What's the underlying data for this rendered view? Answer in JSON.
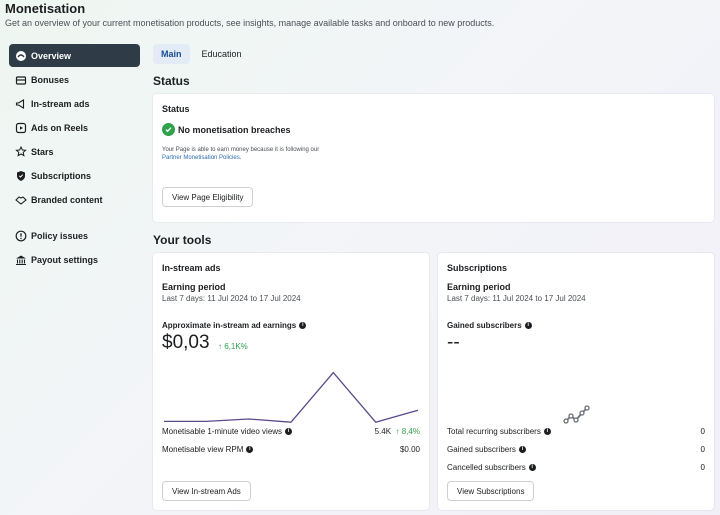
{
  "header": {
    "title": "Monetisation",
    "subtitle": "Get an overview of your current monetisation products, see insights, manage available tasks and onboard to new products."
  },
  "sidebar": {
    "items": [
      {
        "label": "Overview",
        "icon": "overview-icon"
      },
      {
        "label": "Bonuses",
        "icon": "bonus-icon"
      },
      {
        "label": "In-stream ads",
        "icon": "megaphone-icon"
      },
      {
        "label": "Ads on Reels",
        "icon": "reels-icon"
      },
      {
        "label": "Stars",
        "icon": "stars-icon"
      },
      {
        "label": "Subscriptions",
        "icon": "shield-icon"
      },
      {
        "label": "Branded content",
        "icon": "handshake-icon"
      },
      {
        "label": "Policy issues",
        "icon": "alert-icon"
      },
      {
        "label": "Payout settings",
        "icon": "bank-icon"
      }
    ]
  },
  "tabs": [
    {
      "label": "Main"
    },
    {
      "label": "Education"
    }
  ],
  "status": {
    "section_title": "Status",
    "card_title": "Status",
    "headline": "No monetisation breaches",
    "desc_line1": "Your Page is able to earn money because it is following our",
    "desc_link": "Partner Monetisation Policies",
    "desc_end": ".",
    "button": "View Page Eligibility"
  },
  "tools": {
    "section_title": "Your tools",
    "instream": {
      "title": "In-stream ads",
      "period_label": "Earning period",
      "period_value": "Last 7 days: 11 Jul 2024 to 17 Jul 2024",
      "metric_label": "Approximate in-stream ad earnings",
      "metric_value": "$0,03",
      "metric_delta": "↑ 6,1K%",
      "row1_label": "Monetisable 1-minute video views",
      "row1_value": "5.4K",
      "row1_delta": "↑ 8,4%",
      "row2_label": "Monetisable view RPM",
      "row2_value": "$0.00",
      "button": "View In-stream Ads",
      "line_color": "#5b4a8b"
    },
    "subscriptions": {
      "title": "Subscriptions",
      "period_label": "Earning period",
      "period_value": "Last 7 days: 11 Jul 2024 to 17 Jul 2024",
      "metric_label": "Gained subscribers",
      "metric_value": "--",
      "row1_label": "Total recurring subscribers",
      "row1_value": "0",
      "row2_label": "Gained subscribers",
      "row2_value": "0",
      "row3_label": "Cancelled subscribers",
      "row3_value": "0",
      "button": "View Subscriptions"
    }
  },
  "chart_data": {
    "type": "line",
    "x": [
      1,
      2,
      3,
      4,
      5,
      6,
      7
    ],
    "values": [
      0.2,
      0.2,
      0.5,
      0.1,
      6.3,
      0.1,
      1.6
    ],
    "ylim": [
      0,
      7
    ]
  }
}
